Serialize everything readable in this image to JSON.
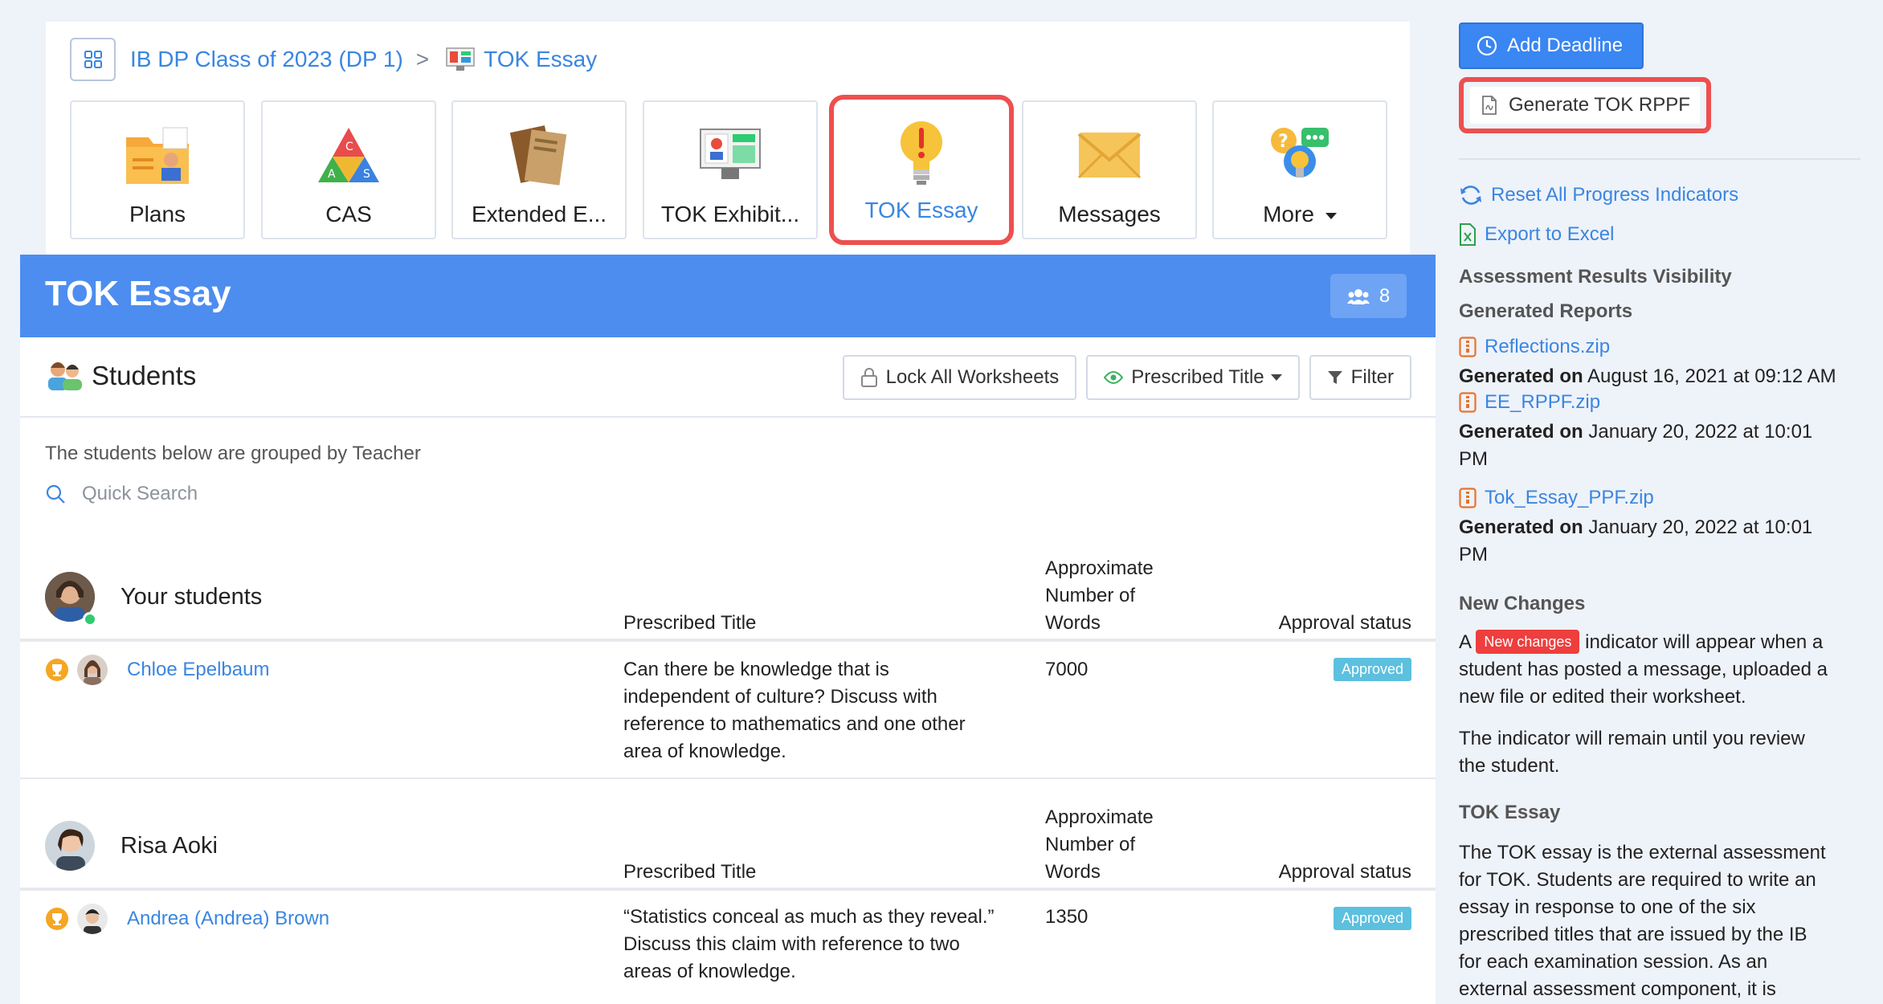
{
  "breadcrumb": {
    "class_name": "IB DP Class of 2023 (DP 1)",
    "separator": ">",
    "current": "TOK Essay"
  },
  "tiles": [
    {
      "label": "Plans",
      "icon": "plans-icon"
    },
    {
      "label": "CAS",
      "icon": "cas-icon"
    },
    {
      "label": "Extended E...",
      "icon": "extended-essay-icon"
    },
    {
      "label": "TOK Exhibit...",
      "icon": "tok-exhibition-icon"
    },
    {
      "label": "TOK Essay",
      "icon": "lightbulb-icon",
      "active": true
    },
    {
      "label": "Messages",
      "icon": "envelope-icon"
    },
    {
      "label": "More",
      "icon": "more-icon"
    }
  ],
  "panel": {
    "title": "TOK Essay",
    "student_count": "8"
  },
  "students_section": {
    "title": "Students",
    "lock_button": "Lock All Worksheets",
    "prescribed_button": "Prescribed Title",
    "filter_button": "Filter",
    "group_note": "The students below are grouped by Teacher",
    "search_placeholder": "Quick Search"
  },
  "groups": [
    {
      "name": "Your students",
      "col_title": "Prescribed Title",
      "col_words_1": "Approximate",
      "col_words_2": "Number of",
      "col_words_3": "Words",
      "col_status": "Approval status",
      "student": {
        "name": "Chloe Epelbaum",
        "title_1": "Can there be knowledge that is",
        "title_2": "independent of culture? Discuss with",
        "title_3": "reference to mathematics and one other",
        "title_4": "area of knowledge.",
        "words": "7000",
        "status": "Approved"
      }
    },
    {
      "name": "Risa Aoki",
      "col_title": "Prescribed Title",
      "col_words_1": "Approximate",
      "col_words_2": "Number of",
      "col_words_3": "Words",
      "col_status": "Approval status",
      "student": {
        "name": "Andrea (Andrea) Brown",
        "title_1": "“Statistics conceal as much as they reveal.”",
        "title_2": "Discuss this claim with reference to two",
        "title_3": "areas of knowledge.",
        "words": "1350",
        "status": "Approved"
      }
    }
  ],
  "sidebar": {
    "add_deadline": "Add Deadline",
    "generate_rppf": "Generate TOK RPPF",
    "reset_progress": "Reset All Progress Indicators",
    "export_excel": "Export to Excel",
    "visibility_heading": "Assessment Results Visibility",
    "reports_heading": "Generated Reports",
    "generated_label": "Generated on",
    "reports": [
      {
        "file": "Reflections.zip",
        "date_1": "August 16, 2021 at 09:12 AM"
      },
      {
        "file": "EE_RPPF.zip",
        "date_1": "January 20, 2022 at 10:01",
        "date_2": "PM"
      },
      {
        "file": "Tok_Essay_PPF.zip",
        "date_1": "January 20, 2022 at 10:01",
        "date_2": "PM"
      }
    ],
    "new_changes_heading": "New Changes",
    "nc_a": "A",
    "nc_badge": "New changes",
    "nc_line_1": "indicator will appear when a",
    "nc_line_2": "student has posted a message, uploaded a",
    "nc_line_3": "new file or edited their worksheet.",
    "nc_para2_1": "The indicator will remain until you review",
    "nc_para2_2": "the student.",
    "tok_heading": "TOK Essay",
    "tok_1": "The TOK essay is the external assessment",
    "tok_2": "for TOK. Students are required to write an",
    "tok_3": "essay in response to one of the six",
    "tok_4": "prescribed titles that are issued by the IB",
    "tok_5": "for each examination session. As an",
    "tok_6": "external assessment component, it is"
  },
  "colors": {
    "accent": "#4d8df0",
    "link": "#3a86e0",
    "highlight": "#ee4f4f",
    "approved": "#5cc0de"
  }
}
